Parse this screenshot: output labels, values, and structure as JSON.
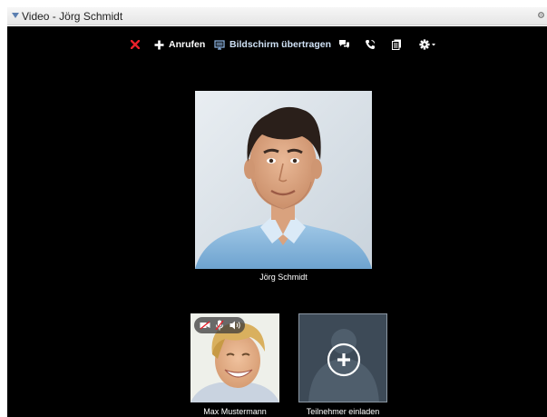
{
  "window": {
    "title": "Video - Jörg Schmidt",
    "collapse_icon": "triangle-down-icon",
    "settings_icon": "gear-icon"
  },
  "toolbar": {
    "hangup_icon": "close-x-icon",
    "call_label": "Anrufen",
    "call_icon": "plus-icon",
    "screen_share_label": "Bildschirm übertragen",
    "screen_share_icon": "monitor-icon",
    "chat_icon": "chat-bubbles-icon",
    "phone_icon": "phone-icon",
    "clipboard_icon": "clipboard-icon",
    "settings_icon": "gear-dropdown-icon"
  },
  "participants": {
    "main": {
      "name": "Jörg Schmidt"
    },
    "self": {
      "name": "Max Mustermann",
      "controls": [
        "camera-off-icon",
        "mic-muted-icon",
        "speaker-icon"
      ]
    },
    "invite": {
      "label": "Teilnehmer einladen",
      "icon": "add-person-icon"
    }
  },
  "colors": {
    "stage_background": "#000000",
    "hangup_red": "#e8202a",
    "titlebar": "#ececec"
  }
}
